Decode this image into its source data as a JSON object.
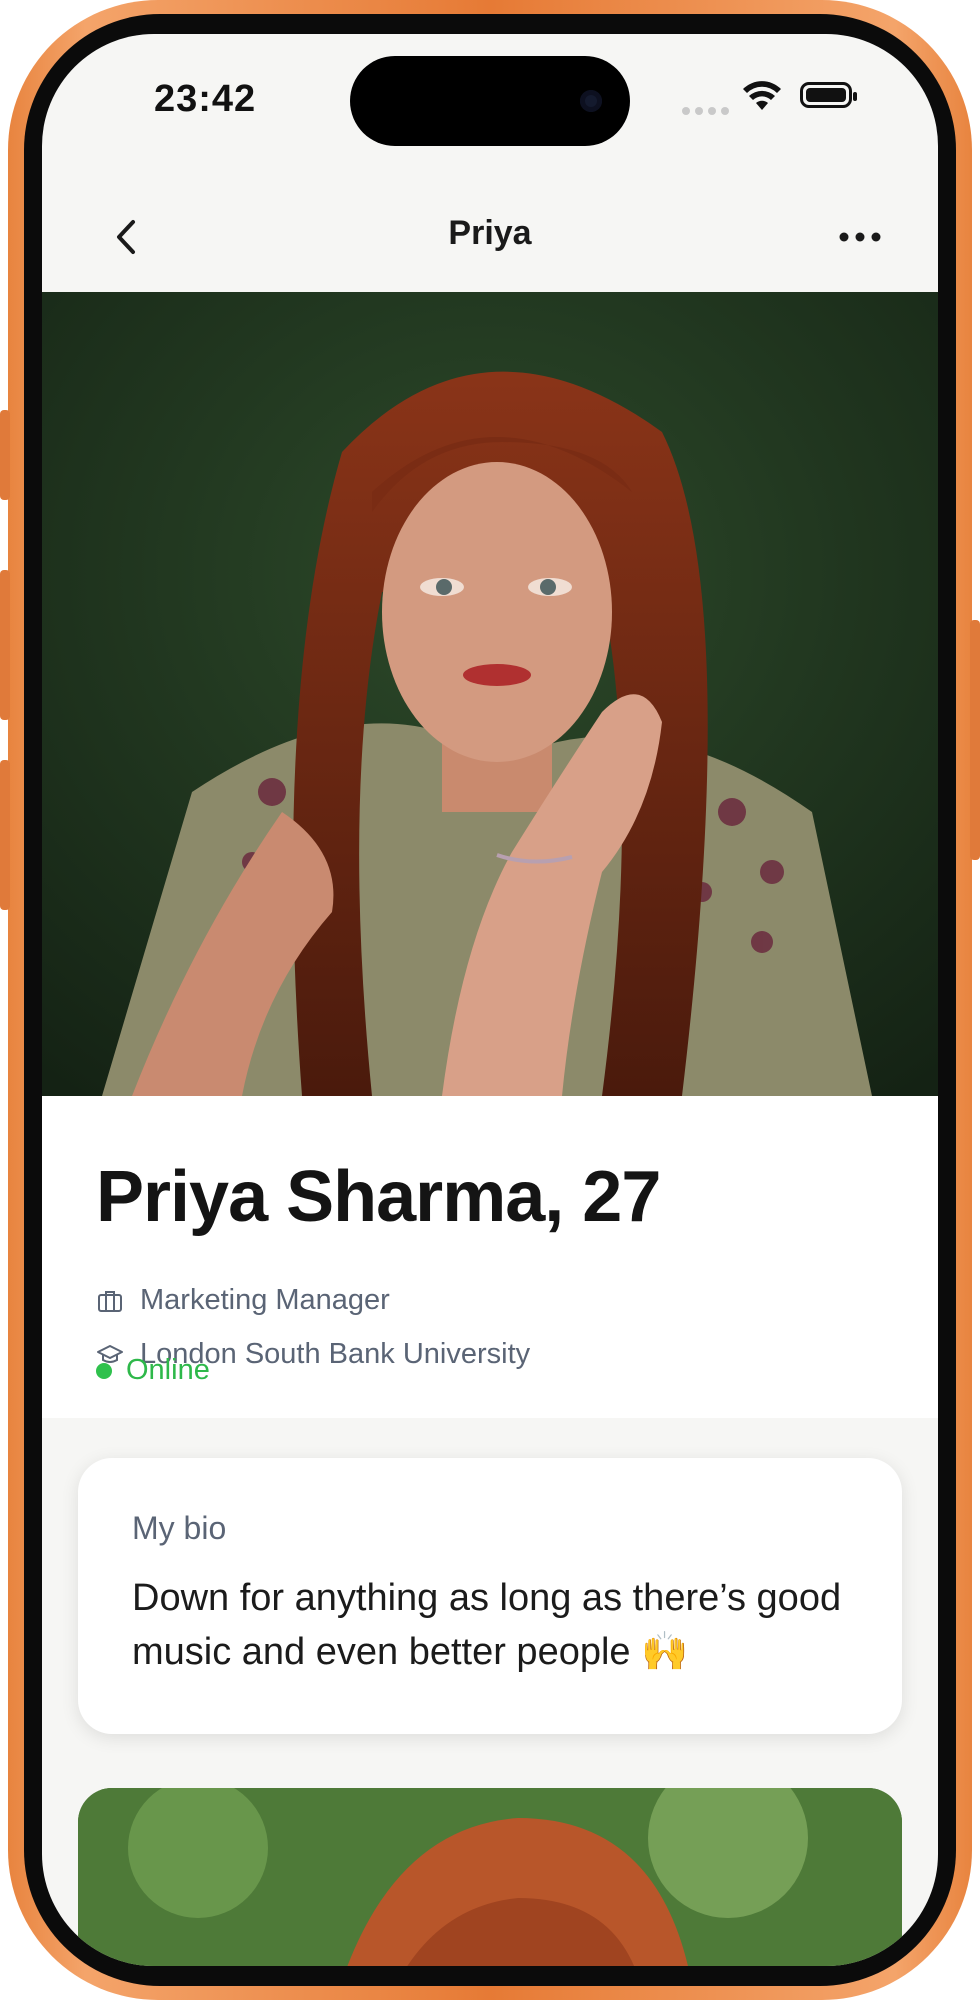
{
  "status_bar": {
    "time": "23:42"
  },
  "nav": {
    "title": "Priya"
  },
  "profile": {
    "name_age": "Priya Sharma, 27",
    "job": "Marketing Manager",
    "education": "London South Bank University",
    "status": "Online"
  },
  "bio": {
    "heading": "My bio",
    "text": "Down for anything as long as there’s good music and even better people 🙌"
  },
  "colors": {
    "frame": "#e8843f",
    "online": "#2fc14d",
    "meta_text": "#5a6475"
  },
  "icons": [
    "chevron-left-icon",
    "more-horizontal-icon",
    "briefcase-icon",
    "graduation-cap-icon",
    "wifi-icon",
    "battery-icon"
  ]
}
